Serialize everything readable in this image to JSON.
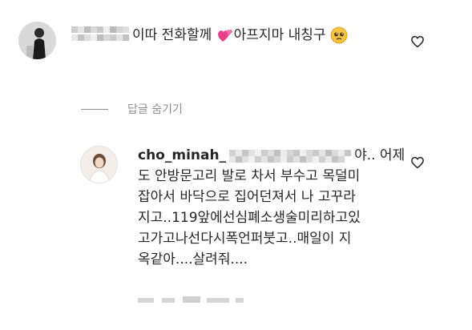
{
  "comments": [
    {
      "text": "이따 전화할께",
      "text_after_emoji": "아프지마 내칭구",
      "emojis": [
        "two-hearts-emoji",
        "pleading-face-emoji"
      ]
    },
    {
      "username": "cho_minah_",
      "lines": [
        "야.. 어제",
        "도 안방문고리 발로 차서 부수고 목덜미",
        "잡아서 바닥으로 집어던져서 나 고꾸라",
        "지고..119앞에선심폐소생술미리하고있",
        "고가고나선다시폭언퍼붓고..매일이 지",
        "옥같아....살려줘...."
      ]
    }
  ],
  "replies_toggle": {
    "label": "답글 숨기기"
  },
  "icons": {
    "like": "heart-outline-icon"
  },
  "colors": {
    "text": "#262626",
    "secondary": "#8e8e8e",
    "heart_emoji": "#e8438a",
    "pleading_emoji": "#f5c542"
  }
}
